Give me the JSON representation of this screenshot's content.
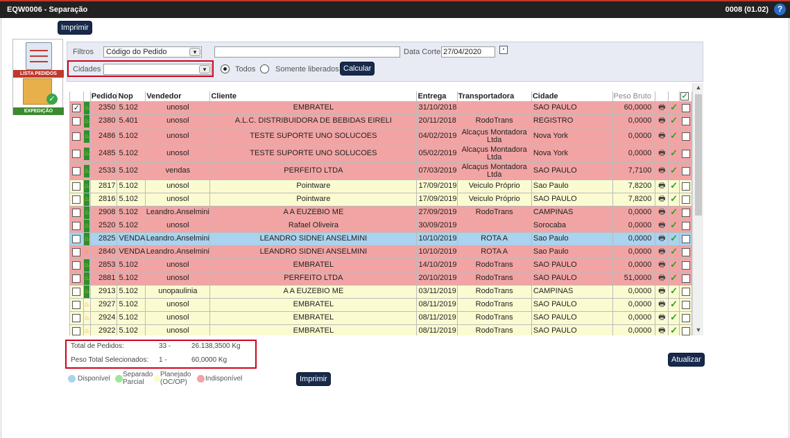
{
  "window": {
    "title": "EQW0006 - Separação",
    "version": "0008 (01.02)",
    "help_icon": "?"
  },
  "top_print_label": "Imprimir",
  "logo": {
    "label1": "LISTA PEDIDOS",
    "label2": "EXPEDIÇÃO"
  },
  "filters": {
    "filtros_label": "Filtros",
    "filtros_select": "Código do Pedido",
    "search_value": "",
    "data_corte_label": "Data Corte",
    "data_corte_value": "27/04/2020",
    "cidades_label": "Cidades",
    "cidades_select": "",
    "radio_todos": "Todos",
    "radio_liberados": "Somente liberados",
    "calcular_label": "Calcular"
  },
  "table": {
    "headers": [
      "Pedido",
      "Nop",
      "Vendedor",
      "Cliente",
      "Entrega",
      "Transportadora",
      "Cidade",
      "Peso Bruto"
    ],
    "rows": [
      {
        "color": "red",
        "checked": true,
        "status": "green",
        "pedido": "2350",
        "nop": "5.102",
        "vendedor": "unosol",
        "cliente": "EMBRATEL",
        "entrega": "31/10/2018",
        "transp": "",
        "cidade": "SAO PAULO",
        "peso": "60,0000"
      },
      {
        "color": "red",
        "checked": false,
        "status": "green",
        "pedido": "2380",
        "nop": "5.401",
        "vendedor": "unosol",
        "cliente": "A.L.C. DISTRIBUIDORA DE BEBIDAS EIRELI",
        "entrega": "20/11/2018",
        "transp": "RodoTrans",
        "cidade": "REGISTRO",
        "peso": "0,0000"
      },
      {
        "color": "red",
        "checked": false,
        "status": "green",
        "pedido": "2486",
        "nop": "5.102",
        "vendedor": "unosol",
        "cliente": "TESTE SUPORTE UNO SOLUCOES",
        "entrega": "04/02/2019",
        "transp": "Alcaçus Montadora Ltda",
        "cidade": "Nova York",
        "peso": "0,0000"
      },
      {
        "color": "red",
        "checked": false,
        "status": "green",
        "pedido": "2485",
        "nop": "5.102",
        "vendedor": "unosol",
        "cliente": "TESTE SUPORTE UNO SOLUCOES",
        "entrega": "05/02/2019",
        "transp": "Alcaçus Montadora Ltda",
        "cidade": "Nova York",
        "peso": "0,0000"
      },
      {
        "color": "red",
        "checked": false,
        "status": "green",
        "pedido": "2533",
        "nop": "5.102",
        "vendedor": "vendas",
        "cliente": "PERFEITO LTDA",
        "entrega": "07/03/2019",
        "transp": "Alcaçus Montadora Ltda",
        "cidade": "SAO PAULO",
        "peso": "7,7100"
      },
      {
        "color": "yel",
        "checked": false,
        "status": "green",
        "pedido": "2817",
        "nop": "5.102",
        "vendedor": "unosol",
        "cliente": "Pointware",
        "entrega": "17/09/2019",
        "transp": "Veiculo Próprio",
        "cidade": "Sao Paulo",
        "peso": "7,8200"
      },
      {
        "color": "yel",
        "checked": false,
        "status": "green",
        "pedido": "2816",
        "nop": "5.102",
        "vendedor": "unosol",
        "cliente": "Pointware",
        "entrega": "17/09/2019",
        "transp": "Veiculo Próprio",
        "cidade": "SAO PAULO",
        "peso": "7,8200"
      },
      {
        "color": "red",
        "checked": false,
        "status": "green",
        "pedido": "2908",
        "nop": "5.102",
        "vendedor": "Leandro.Anselmini",
        "cliente": "A A EUZEBIO ME",
        "entrega": "27/09/2019",
        "transp": "RodoTrans",
        "cidade": "CAMPINAS",
        "peso": "0,0000"
      },
      {
        "color": "red",
        "checked": false,
        "status": "green",
        "pedido": "2520",
        "nop": "5.102",
        "vendedor": "unosol",
        "cliente": "Rafael Oliveira",
        "entrega": "30/09/2019",
        "transp": "",
        "cidade": "Sorocaba",
        "peso": "0,0000"
      },
      {
        "color": "blu",
        "checked": false,
        "status": "green",
        "pedido": "2825",
        "nop": "VENDA",
        "vendedor": "Leandro.Anselmini",
        "cliente": "LEANDRO SIDNEI ANSELMINI",
        "entrega": "10/10/2019",
        "transp": "ROTA A",
        "cidade": "Sao Paulo",
        "peso": "0,0000"
      },
      {
        "color": "red",
        "checked": false,
        "status": "none",
        "pedido": "2840",
        "nop": "VENDA",
        "vendedor": "Leandro.Anselmini",
        "cliente": "LEANDRO SIDNEI ANSELMINI",
        "entrega": "10/10/2019",
        "transp": "ROTA A",
        "cidade": "Sao Paulo",
        "peso": "0,0000"
      },
      {
        "color": "red",
        "checked": false,
        "status": "green",
        "pedido": "2853",
        "nop": "5.102",
        "vendedor": "unosol",
        "cliente": "EMBRATEL",
        "entrega": "14/10/2019",
        "transp": "RodoTrans",
        "cidade": "SAO PAULO",
        "peso": "0,0000"
      },
      {
        "color": "red",
        "checked": false,
        "status": "green",
        "pedido": "2881",
        "nop": "5.102",
        "vendedor": "unosol",
        "cliente": "PERFEITO LTDA",
        "entrega": "20/10/2019",
        "transp": "RodoTrans",
        "cidade": "SAO PAULO",
        "peso": "51,0000"
      },
      {
        "color": "yel",
        "checked": false,
        "status": "green",
        "pedido": "2913",
        "nop": "5.102",
        "vendedor": "unopaulinia",
        "cliente": "A A EUZEBIO ME",
        "entrega": "03/11/2019",
        "transp": "RodoTrans",
        "cidade": "CAMPINAS",
        "peso": "0,0000"
      },
      {
        "color": "yel",
        "checked": false,
        "status": "none",
        "pedido": "2927",
        "nop": "5.102",
        "vendedor": "unosol",
        "cliente": "EMBRATEL",
        "entrega": "08/11/2019",
        "transp": "RodoTrans",
        "cidade": "SAO PAULO",
        "peso": "0,0000"
      },
      {
        "color": "yel",
        "checked": false,
        "status": "none",
        "pedido": "2924",
        "nop": "5.102",
        "vendedor": "unosol",
        "cliente": "EMBRATEL",
        "entrega": "08/11/2019",
        "transp": "RodoTrans",
        "cidade": "SAO PAULO",
        "peso": "0,0000"
      },
      {
        "color": "yel",
        "checked": false,
        "status": "none",
        "pedido": "2922",
        "nop": "5.102",
        "vendedor": "unosol",
        "cliente": "EMBRATEL",
        "entrega": "08/11/2019",
        "transp": "RodoTrans",
        "cidade": "SAO PAULO",
        "peso": "0,0000"
      }
    ]
  },
  "summary": {
    "total_label": "Total de Pedidos:",
    "total_count": "33 -",
    "total_weight": "26.138,3500 Kg",
    "sel_label": "Peso Total Selecionados:",
    "sel_count": "1 -",
    "sel_weight": "60,0000 Kg"
  },
  "legend": {
    "disponivel": "Disponível",
    "separado": "Separado Parcial",
    "planejado": "Planejado (OC/OP)",
    "indisponivel": "Indisponível",
    "colors": {
      "disponivel": "#a9d3ef",
      "separado": "#9be89b",
      "planejado": "#fbfbd2",
      "indisponivel": "#f2a4a4"
    }
  },
  "bottom_print_label": "Imprimir",
  "atualizar_label": "Atualizar"
}
